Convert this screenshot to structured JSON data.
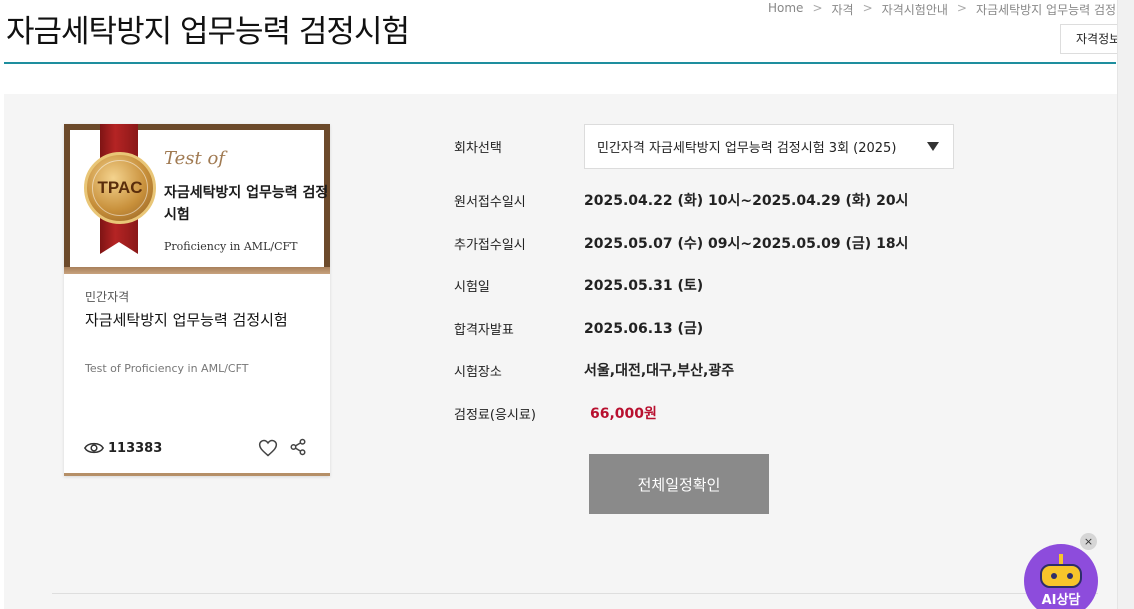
{
  "header": {
    "title": "자금세탁방지 업무능력 검정시험",
    "breadcrumb": [
      "Home",
      "자격",
      "자격시험안내",
      "자금세탁방지 업무능력 검정"
    ],
    "qualification_button": "자격정보"
  },
  "card": {
    "banner": {
      "badge": "TPAC",
      "script": "Test of",
      "title": "자금세탁방지 업무능력 검정시험",
      "subtitle": "Proficiency in AML/CFT"
    },
    "category": "민간자격",
    "name": "자금세탁방지 업무능력 검정시험",
    "english_name": "Test of Proficiency in AML/CFT",
    "view_count": "113383"
  },
  "details": {
    "round_label": "회차선택",
    "round_selected": "민간자격 자금세탁방지 업무능력 검정시험 3회 (2025)",
    "rows": [
      {
        "label": "원서접수일시",
        "value": "2025.04.22 (화) 10시~2025.04.29 (화) 20시"
      },
      {
        "label": "추가접수일시",
        "value": "2025.05.07 (수) 09시~2025.05.09 (금) 18시"
      },
      {
        "label": "시험일",
        "value": "2025.05.31 (토)"
      },
      {
        "label": "합격자발표",
        "value": "2025.06.13 (금)"
      },
      {
        "label": "시험장소",
        "value": "서울,대전,대구,부산,광주"
      }
    ],
    "fee_label": "검정료(응시료)",
    "fee_value": "66,000원",
    "schedule_button": "전체일정확인"
  },
  "ai_chat": {
    "label": "AI상담",
    "close": "×"
  },
  "colors": {
    "accent_rule": "#1e8e9e",
    "fee": "#b8102f",
    "button": "#8a8a8a",
    "ai_bot": "#8d4cdc"
  }
}
